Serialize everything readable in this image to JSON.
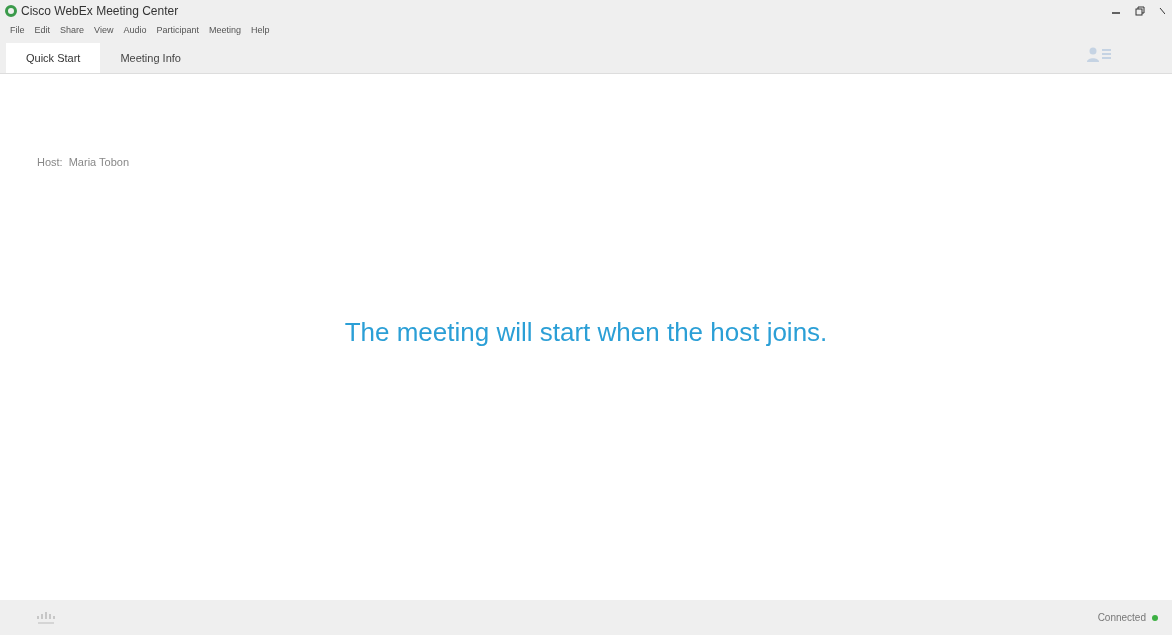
{
  "window": {
    "title": "Cisco WebEx Meeting Center"
  },
  "menu": [
    "File",
    "Edit",
    "Share",
    "View",
    "Audio",
    "Participant",
    "Meeting",
    "Help"
  ],
  "tabs": [
    {
      "label": "Quick Start",
      "selected": true
    },
    {
      "label": "Meeting Info",
      "selected": false
    }
  ],
  "host": {
    "label": "Host:",
    "name": "Maria Tobon"
  },
  "message": "The meeting will start when the host joins.",
  "status_bar": {
    "status": "Connected",
    "connected": true
  }
}
